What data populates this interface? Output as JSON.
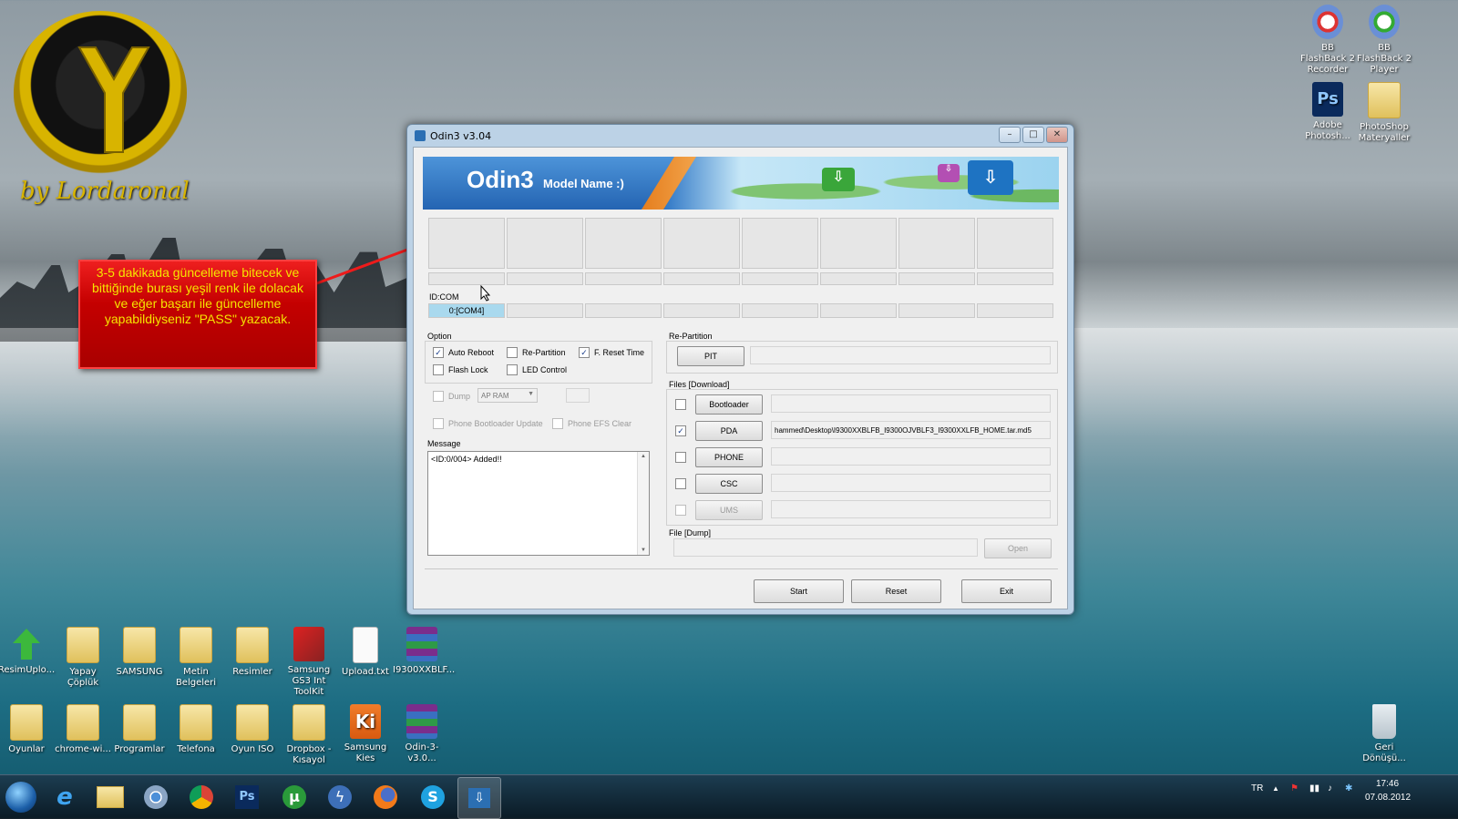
{
  "logo": {
    "text": "by Lordaronal"
  },
  "annotation": {
    "text": "3-5 dakikada güncelleme bitecek ve bittiğinde burası yeşil renk ile dolacak ve eğer başarı ile güncelleme yapabildiyseniz \"PASS\" yazacak."
  },
  "desktop": {
    "top_right": [
      {
        "label": "BB FlashBack 2 Recorder",
        "icon": "flashback-recorder-icon"
      },
      {
        "label": "BB FlashBack 2 Player",
        "icon": "flashback-player-icon"
      },
      {
        "label": "Adobe Photosh...",
        "icon": "photoshop-icon"
      },
      {
        "label": "PhotoShop Materyaller",
        "icon": "folder-icon"
      }
    ],
    "row1": [
      "ResimUplo...",
      "Yapay Çöplük",
      "SAMSUNG",
      "Metin Belgeleri",
      "Resimler",
      "Samsung GS3 Int ToolKit",
      "Upload.txt",
      "I9300XXBLF..."
    ],
    "row2": [
      "Oyunlar",
      "chrome-wi...",
      "Programlar",
      "Telefona",
      "Oyun ISO",
      "Dropbox - Kısayol",
      "Samsung Kies",
      "Odin-3-v3.0..."
    ],
    "recycle": "Geri Dönüşü..."
  },
  "window": {
    "title": "Odin3 v3.04",
    "banner_title": "Odin3",
    "banner_model": "Model Name :)",
    "id_com_label": "ID:COM",
    "com_ports": [
      "0:[COM4]",
      "",
      "",
      "",
      "",
      "",
      "",
      ""
    ],
    "option": {
      "label": "Option",
      "auto_reboot": "Auto Reboot",
      "re_partition": "Re-Partition",
      "f_reset_time": "F. Reset Time",
      "flash_lock": "Flash Lock",
      "led_control": "LED Control",
      "dump": "Dump",
      "dump_select": "AP RAM",
      "phone_bootloader_update": "Phone Bootloader Update",
      "phone_efs_clear": "Phone EFS Clear"
    },
    "message": {
      "label": "Message",
      "text": "<ID:0/004> Added!!"
    },
    "repartition": {
      "label": "Re-Partition",
      "pit": "PIT"
    },
    "files": {
      "label": "Files [Download]",
      "bootloader": "Bootloader",
      "pda": "PDA",
      "pda_path": "hammed\\Desktop\\I9300XXBLFB_I9300OJVBLF3_I9300XXLFB_HOME.tar.md5",
      "phone": "PHONE",
      "csc": "CSC",
      "ums": "UMS"
    },
    "file_dump": {
      "label": "File [Dump]",
      "open": "Open"
    },
    "buttons": {
      "start": "Start",
      "reset": "Reset",
      "exit": "Exit"
    }
  },
  "taskbar": {
    "lang": "TR",
    "time": "17:46",
    "date": "07.08.2012"
  }
}
